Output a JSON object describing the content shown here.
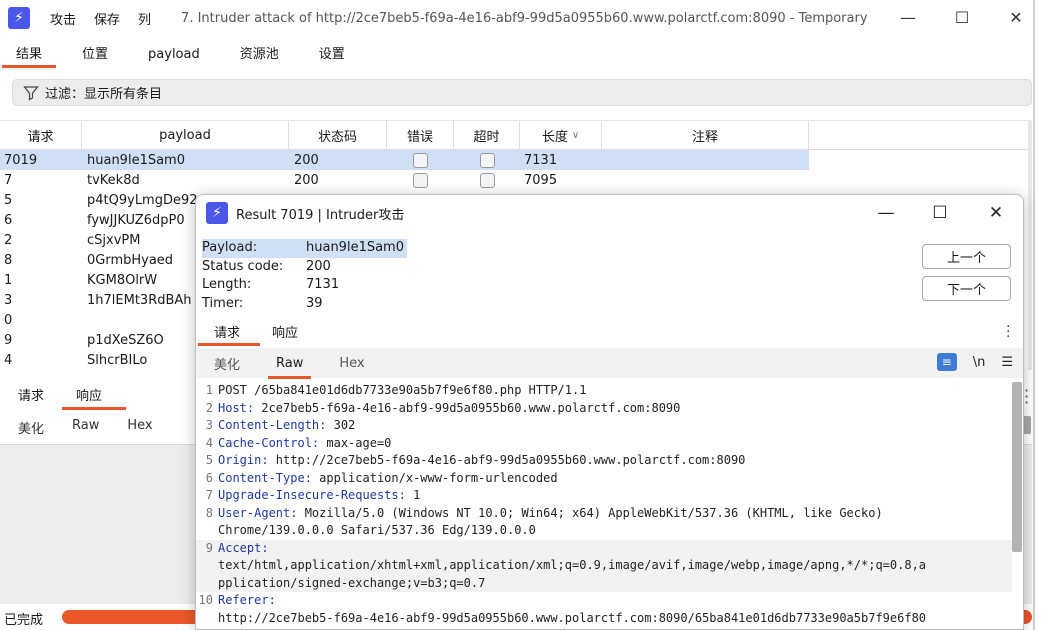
{
  "main": {
    "menu": [
      "攻击",
      "保存",
      "列"
    ],
    "title": "7. Intruder attack of http://2ce7beb5-f69a-4e16-abf9-99d5a0955b60.www.polarctf.com:8090 - Temporary",
    "tabs": [
      "结果",
      "位置",
      "payload",
      "资源池",
      "设置"
    ],
    "filter_label": "过滤：显示所有条目",
    "table": {
      "headers": [
        "请求",
        "payload",
        "状态码",
        "错误",
        "超时",
        "长度",
        "注释"
      ],
      "rows": [
        {
          "req": "7019",
          "payload": "huan9le1Sam0",
          "status": "200",
          "len": "7131"
        },
        {
          "req": "7",
          "payload": "tvKek8d",
          "status": "200",
          "len": "7095"
        },
        {
          "req": "5",
          "payload": "p4tQ9yLmgDe92",
          "status": "",
          "len": ""
        },
        {
          "req": "6",
          "payload": "fywJJKUZ6dpP0",
          "status": "",
          "len": ""
        },
        {
          "req": "2",
          "payload": "cSjxvPM",
          "status": "",
          "len": ""
        },
        {
          "req": "8",
          "payload": "0GrmbHyaed",
          "status": "",
          "len": ""
        },
        {
          "req": "1",
          "payload": "KGM8OlrW",
          "status": "",
          "len": ""
        },
        {
          "req": "3",
          "payload": "1h7lEMt3RdBAh",
          "status": "",
          "len": ""
        },
        {
          "req": "0",
          "payload": "",
          "status": "",
          "len": ""
        },
        {
          "req": "9",
          "payload": "p1dXeSZ6O",
          "status": "",
          "len": ""
        },
        {
          "req": "4",
          "payload": "SlhcrBILo",
          "status": "",
          "len": ""
        }
      ]
    },
    "lower_tabs": [
      "请求",
      "响应"
    ],
    "lower_views": [
      "美化",
      "Raw",
      "Hex"
    ],
    "status": "已完成"
  },
  "dialog": {
    "title": "Result 7019 | Intruder攻击",
    "meta": [
      {
        "k": "Payload:",
        "v": "huan9le1Sam0"
      },
      {
        "k": "Status code:",
        "v": "200"
      },
      {
        "k": "Length:",
        "v": "7131"
      },
      {
        "k": "Timer:",
        "v": "39"
      }
    ],
    "prev_label": "上一个",
    "next_label": "下一个",
    "tabs": [
      "请求",
      "响应"
    ],
    "views": [
      "美化",
      "Raw",
      "Hex"
    ],
    "newline_label": "\\n",
    "code_lines": [
      {
        "n": "1",
        "name": "",
        "rest": "POST /65ba841e01d6db7733e90a5b7f9e6f80.php HTTP/1.1"
      },
      {
        "n": "2",
        "name": "Host:",
        "rest": " 2ce7beb5-f69a-4e16-abf9-99d5a0955b60.www.polarctf.com:8090"
      },
      {
        "n": "3",
        "name": "Content-Length:",
        "rest": " 302"
      },
      {
        "n": "4",
        "name": "Cache-Control:",
        "rest": " max-age=0"
      },
      {
        "n": "5",
        "name": "Origin:",
        "rest": " http://2ce7beb5-f69a-4e16-abf9-99d5a0955b60.www.polarctf.com:8090"
      },
      {
        "n": "6",
        "name": "Content-Type:",
        "rest": " application/x-www-form-urlencoded"
      },
      {
        "n": "7",
        "name": "Upgrade-Insecure-Requests:",
        "rest": " 1"
      },
      {
        "n": "8",
        "name": "User-Agent:",
        "rest": " Mozilla/5.0 (Windows NT 10.0; Win64; x64) AppleWebKit/537.36 (KHTML, like Gecko)"
      },
      {
        "n": "",
        "name": "",
        "rest": "Chrome/139.0.0.0 Safari/537.36 Edg/139.0.0.0"
      },
      {
        "n": "9",
        "name": "Accept:",
        "rest": ""
      },
      {
        "n": "",
        "name": "",
        "rest": "text/html,application/xhtml+xml,application/xml;q=0.9,image/avif,image/webp,image/apng,*/*;q=0.8,a"
      },
      {
        "n": "",
        "name": "",
        "rest": "pplication/signed-exchange;v=b3;q=0.7"
      },
      {
        "n": "10",
        "name": "Referer:",
        "rest": ""
      },
      {
        "n": "",
        "name": "",
        "rest": "http://2ce7beb5-f69a-4e16-abf9-99d5a0955b60.www.polarctf.com:8090/65ba841e01d6db7733e90a5b7f9e6f80"
      }
    ]
  },
  "colors": {
    "accent": "#e9572a",
    "selection": "#cfe0f5",
    "logo": "#4a57e8",
    "wrap_icon": "#3d7bd4"
  }
}
